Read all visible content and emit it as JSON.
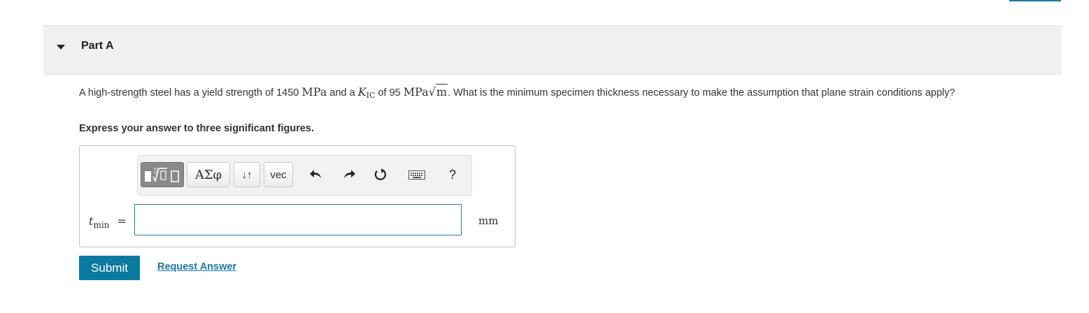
{
  "part": {
    "title": "Part A",
    "caret_icon": "caret-down-icon"
  },
  "question": {
    "text_1": "A high-strength steel has a yield strength of 1450 ",
    "unit_1": "MPa",
    "text_2": " and a ",
    "kic_symbol": "K",
    "kic_sub": "IC",
    "text_3": " of 95 ",
    "unit_2": "MPa",
    "sqrt_content": "m",
    "text_4": ". What is the minimum specimen thickness necessary to make the assumption that plane strain conditions apply?"
  },
  "instruction": "Express your answer to three significant figures.",
  "toolbar": {
    "templates_icon": "templates-icon",
    "greek_label": "ΑΣφ",
    "arrows_label": "↓↑",
    "vec_label": "vec",
    "undo_icon": "undo-icon",
    "redo_icon": "redo-icon",
    "reset_icon": "reset-icon",
    "keyboard_icon": "keyboard-icon",
    "help_label": "?"
  },
  "answer": {
    "variable": "t",
    "variable_sub": "min",
    "equals": "=",
    "value": "",
    "unit": "mm"
  },
  "actions": {
    "submit_label": "Submit",
    "request_label": "Request Answer"
  },
  "colors": {
    "submit_bg": "#0b7aa0",
    "link": "#1a77a8",
    "header_bg": "#f0f0f0"
  }
}
